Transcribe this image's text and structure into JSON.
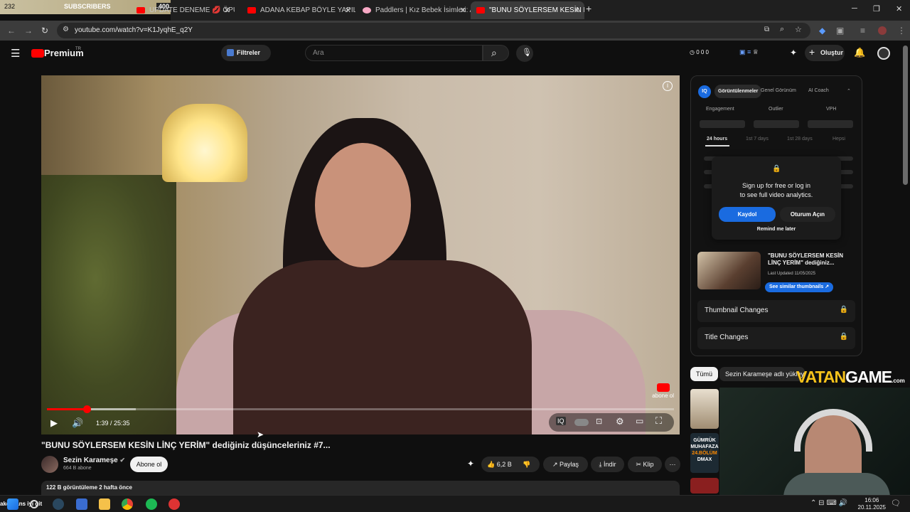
{
  "overlay": {
    "sub_count": "232",
    "sub_label": "SUBSCRIBERS",
    "sub_goal": "400"
  },
  "tabs": [
    {
      "label": "UPDATE DENEME 💋 ÖPÜCÜK"
    },
    {
      "label": "ADANA KEBAP BÖYLE YAPILIR"
    },
    {
      "label": "Paddlers | Kız Bebek İsimleri: Ar"
    },
    {
      "label": "\"BUNU SÖYLERSEM KESİN L"
    }
  ],
  "address": {
    "url": "youtube.com/watch?v=K1JyqhE_q2Y"
  },
  "header": {
    "brand": "Premium",
    "brand_sup": "TR",
    "filters": "Filtreler",
    "search_placeholder": "Ara",
    "stats": "0  0  0",
    "create": "Oluştur"
  },
  "video": {
    "time": "1:39 / 25:35",
    "progress": 0.064,
    "watermark": "abone ol"
  },
  "meta": {
    "title": "\"BUNU SÖYLERSEM KESİN LİNÇ YERİM\" dediğiniz düşünceleriniz #7...",
    "channel": "Sezin Karameşe",
    "subs": "664 B abone",
    "subscribe": "Abone ol",
    "likes": "6,2 B",
    "share": "Paylaş",
    "download": "İndir",
    "clip": "Klip",
    "views": "122 B görüntüleme  2 hafta önce"
  },
  "panel": {
    "tabs": [
      "Görüntülenmeler",
      "Genel Görünüm",
      "AI Coach"
    ],
    "metrics": [
      "Engagement",
      "Outlier",
      "VPH"
    ],
    "periods": [
      "24 hours",
      "1st 7 days",
      "1st 28 days",
      "Hepsi"
    ],
    "lock_text_1": "Sign up for free or log in",
    "lock_text_2": "to see full video analytics.",
    "signup": "Kaydol",
    "login": "Oturum Açın",
    "remind": "Remind me later",
    "thumb_title": "\"BUNU SÖYLERSEM KESİN LİNÇ YERİM\" dediğiniz...",
    "thumb_updated": "Last Updated 11/05/2025",
    "similar": "See similar thumbnails",
    "thumbnail_changes": "Thumbnail Changes",
    "title_changes": "Title Changes"
  },
  "chips": {
    "all": "Tümü",
    "channel": "Sezin Karameşe adlı yükleyi"
  },
  "brand_overlay": {
    "a": "VATAN",
    "b": "GAME",
    "suffix": ".com"
  },
  "side_thumbs": {
    "t2_line1": "GÜMRÜK",
    "t2_line2": "MUHAFAZA",
    "t2_line3": "24.BÖLÜM",
    "t2_line4": "DMAX"
  },
  "taskbar": {
    "ticker": "akcialans iyi git",
    "time": "16:06",
    "date": "20.11.2025"
  }
}
